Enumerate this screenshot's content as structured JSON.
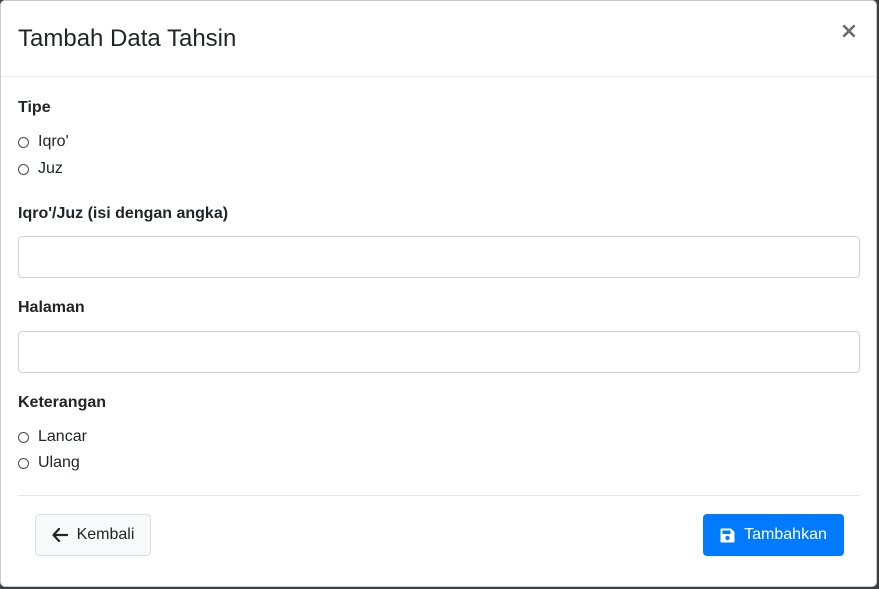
{
  "modal": {
    "title": "Tambah Data Tahsin",
    "close_label": "×"
  },
  "form": {
    "tipe": {
      "label": "Tipe",
      "options": [
        "Iqro'",
        "Juz"
      ]
    },
    "iqro_juz": {
      "label": "Iqro'/Juz (isi dengan angka)",
      "value": "",
      "placeholder": ""
    },
    "halaman": {
      "label": "Halaman",
      "value": "",
      "placeholder": ""
    },
    "keterangan": {
      "label": "Keterangan",
      "options": [
        "Lancar",
        "Ulang"
      ]
    }
  },
  "footer": {
    "back_label": "Kembali",
    "back_icon": "arrow-left-icon",
    "submit_label": "Tambahkan",
    "submit_icon": "save-icon",
    "submit_color": "#007bff"
  }
}
